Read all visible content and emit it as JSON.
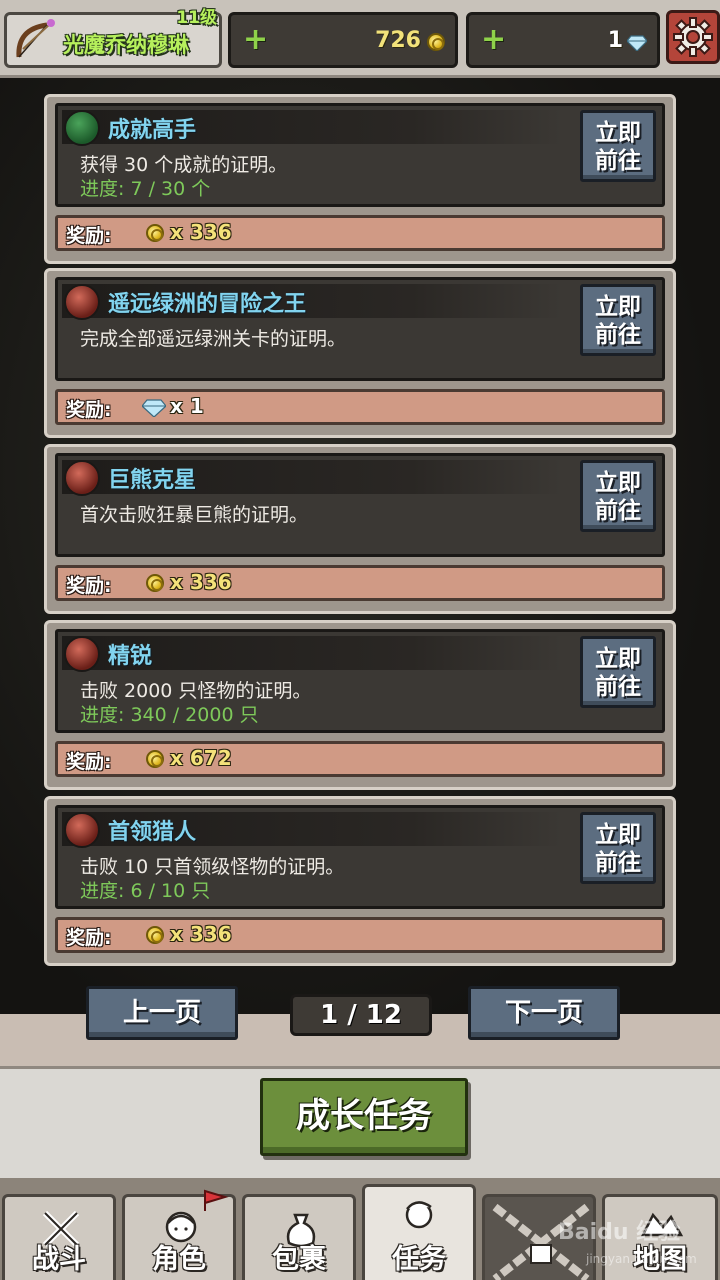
{
  "player": {
    "name": "光魔乔纳穆琳",
    "level": "11级"
  },
  "currency": {
    "gold": {
      "value": "726"
    },
    "gems": {
      "value": "1"
    }
  },
  "quests": [
    {
      "title": "成就高手",
      "icon": "hourglass-icon",
      "description": "获得 30 个成就的证明。",
      "progress": "进度: 7 / 30 个",
      "go_label_1": "立即",
      "go_label_2": "前往",
      "reward_label": "奖励:",
      "reward_type": "gold",
      "reward_value": "x 336"
    },
    {
      "title": "遥远绿洲的冒险之王",
      "icon": "sword-icon",
      "description": "完成全部遥远绿洲关卡的证明。",
      "progress": "",
      "go_label_1": "立即",
      "go_label_2": "前往",
      "reward_label": "奖励:",
      "reward_type": "gem",
      "reward_value": "x 1"
    },
    {
      "title": "巨熊克星",
      "icon": "sword-icon",
      "description": "首次击败狂暴巨熊的证明。",
      "progress": "",
      "go_label_1": "立即",
      "go_label_2": "前往",
      "reward_label": "奖励:",
      "reward_type": "gold",
      "reward_value": "x 336"
    },
    {
      "title": "精锐",
      "icon": "sword-icon",
      "description": "击败 2000 只怪物的证明。",
      "progress": "进度: 340 / 2000 只",
      "go_label_1": "立即",
      "go_label_2": "前往",
      "reward_label": "奖励:",
      "reward_type": "gold",
      "reward_value": "x 672"
    },
    {
      "title": "首领猎人",
      "icon": "sword-icon",
      "description": "击败 10 只首领级怪物的证明。",
      "progress": "进度: 6 / 10 只",
      "go_label_1": "立即",
      "go_label_2": "前往",
      "reward_label": "奖励:",
      "reward_type": "gold",
      "reward_value": "x 336"
    }
  ],
  "pagination": {
    "prev_label": "上一页",
    "next_label": "下一页",
    "indicator": "1 / 12"
  },
  "mode": {
    "label": "成长任务"
  },
  "nav": {
    "tabs": [
      {
        "label": "战斗",
        "icon": "swords-icon"
      },
      {
        "label": "角色",
        "icon": "character-icon"
      },
      {
        "label": "包裹",
        "icon": "bag-icon"
      },
      {
        "label": "任务",
        "icon": "quest-icon"
      },
      {
        "label": "",
        "icon": "locked-chain-icon"
      },
      {
        "label": "地图",
        "icon": "map-icon"
      }
    ]
  },
  "watermark": {
    "text": "Baidu 经验",
    "sub": "jingyan.baidu.com"
  },
  "colors": {
    "quest_title": "#82d4ef",
    "progress": "#7ec95a",
    "gold_text": "#f2e27a",
    "mode_button": "#6c8f3c",
    "page_button": "#5c6d80"
  }
}
